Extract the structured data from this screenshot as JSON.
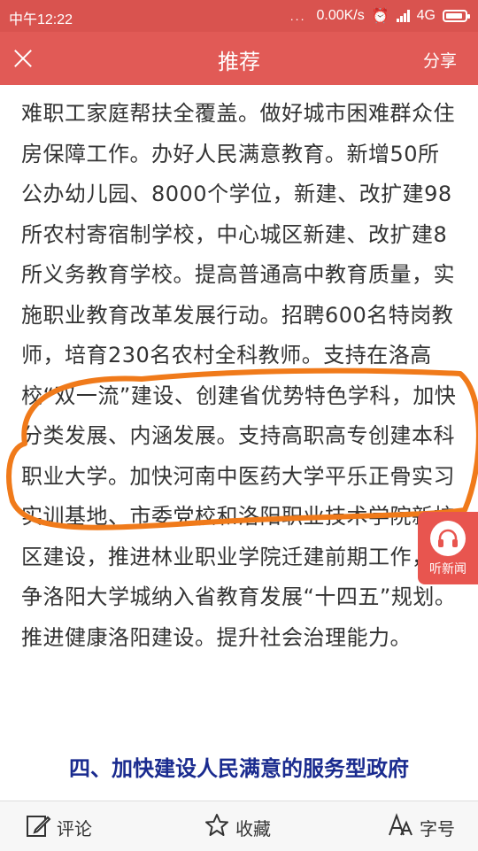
{
  "status": {
    "time": "中午12:22",
    "dots": "...",
    "speed": "0.00K/s",
    "network": "4G"
  },
  "header": {
    "title": "推荐",
    "share_label": "分享"
  },
  "article": {
    "body": "难职工家庭帮扶全覆盖。做好城市困难群众住房保障工作。办好人民满意教育。新增50所公办幼儿园、8000个学位，新建、改扩建98所农村寄宿制学校，中心城区新建、改扩建8所义务教育学校。提高普通高中教育质量，实施职业教育改革发展行动。招聘600名特岗教师，培育230名农村全科教师。支持在洛高校“双一流”建设、创建省优势特色学科，加快分类发展、内涵发展。支持高职高专创建本科职业大学。加快河南中医药大学平乐正骨实习实训基地、市委党校和洛阳职业技术学院新校区建设，推进林业职业学院迁建前期工作，力争洛阳大学城纳入省教育发展“十四五”规划。推进健康洛阳建设。提升社会治理能力。",
    "section_heading": "四、加快建设人民满意的服务型政府"
  },
  "float_button": {
    "label": "听新闻",
    "icon": "headphones-icon"
  },
  "bottombar": {
    "comment": "评论",
    "favorite": "收藏",
    "fontsize": "字号"
  },
  "colors": {
    "header": "#e15a56",
    "annotation": "#f07a1a",
    "heading": "#1a2b8f"
  }
}
